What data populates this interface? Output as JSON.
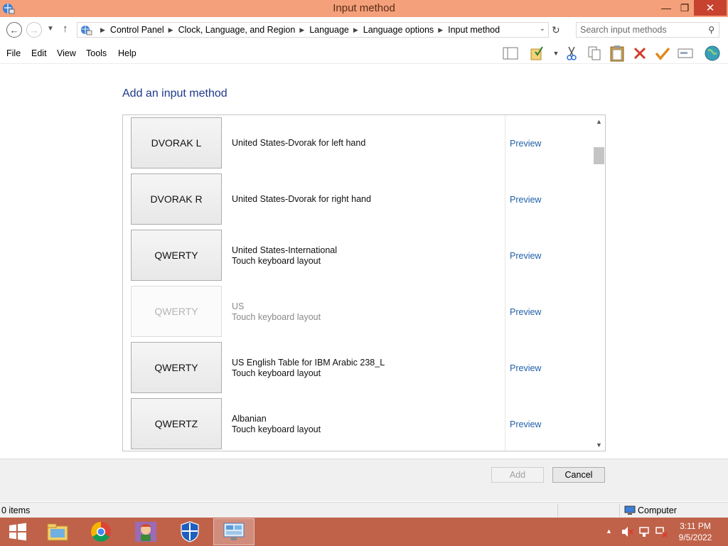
{
  "window": {
    "title": "Input method",
    "minimize_glyph": "—",
    "maximize_glyph": "❐",
    "close_glyph": "✕"
  },
  "address": {
    "breadcrumbs": [
      "Control Panel",
      "Clock, Language, and Region",
      "Language",
      "Language options",
      "Input method"
    ],
    "search_placeholder": "Search input methods"
  },
  "menu": {
    "items": [
      "File",
      "Edit",
      "View",
      "Tools",
      "Help"
    ]
  },
  "toolbar": {
    "icons": [
      "layout-pane-icon",
      "properties-icon",
      "cut-icon",
      "copy-icon",
      "paste-icon",
      "delete-icon",
      "checkmark-icon",
      "rename-icon",
      "globe-icon"
    ]
  },
  "content": {
    "heading": "Add an input method",
    "preview_label": "Preview",
    "rows": [
      {
        "layout": "DVORAK L",
        "line1": "United States-Dvorak for left hand",
        "line2": "",
        "enabled": true
      },
      {
        "layout": "DVORAK R",
        "line1": "United States-Dvorak for right hand",
        "line2": "",
        "enabled": true
      },
      {
        "layout": "QWERTY",
        "line1": "United States-International",
        "line2": "Touch keyboard layout",
        "enabled": true
      },
      {
        "layout": "QWERTY",
        "line1": "US",
        "line2": "Touch keyboard layout",
        "enabled": false
      },
      {
        "layout": "QWERTY",
        "line1": "US English Table for IBM Arabic 238_L",
        "line2": "Touch keyboard layout",
        "enabled": true
      },
      {
        "layout": "QWERTZ",
        "line1": "Albanian",
        "line2": "Touch keyboard layout",
        "enabled": true
      }
    ]
  },
  "buttons": {
    "add": "Add",
    "cancel": "Cancel"
  },
  "status": {
    "items_count": "0 items",
    "location": "Computer"
  },
  "taskbar": {
    "apps": [
      "file-explorer-icon",
      "chrome-icon",
      "game-app-icon",
      "defender-shield-icon",
      "control-panel-icon"
    ],
    "time": "3:11 PM",
    "date": "9/5/2022"
  },
  "colors": {
    "titlebar": "#f4a07a",
    "taskbar": "#c0624a",
    "link": "#1f5fa8",
    "heading": "#1e3a8a"
  }
}
